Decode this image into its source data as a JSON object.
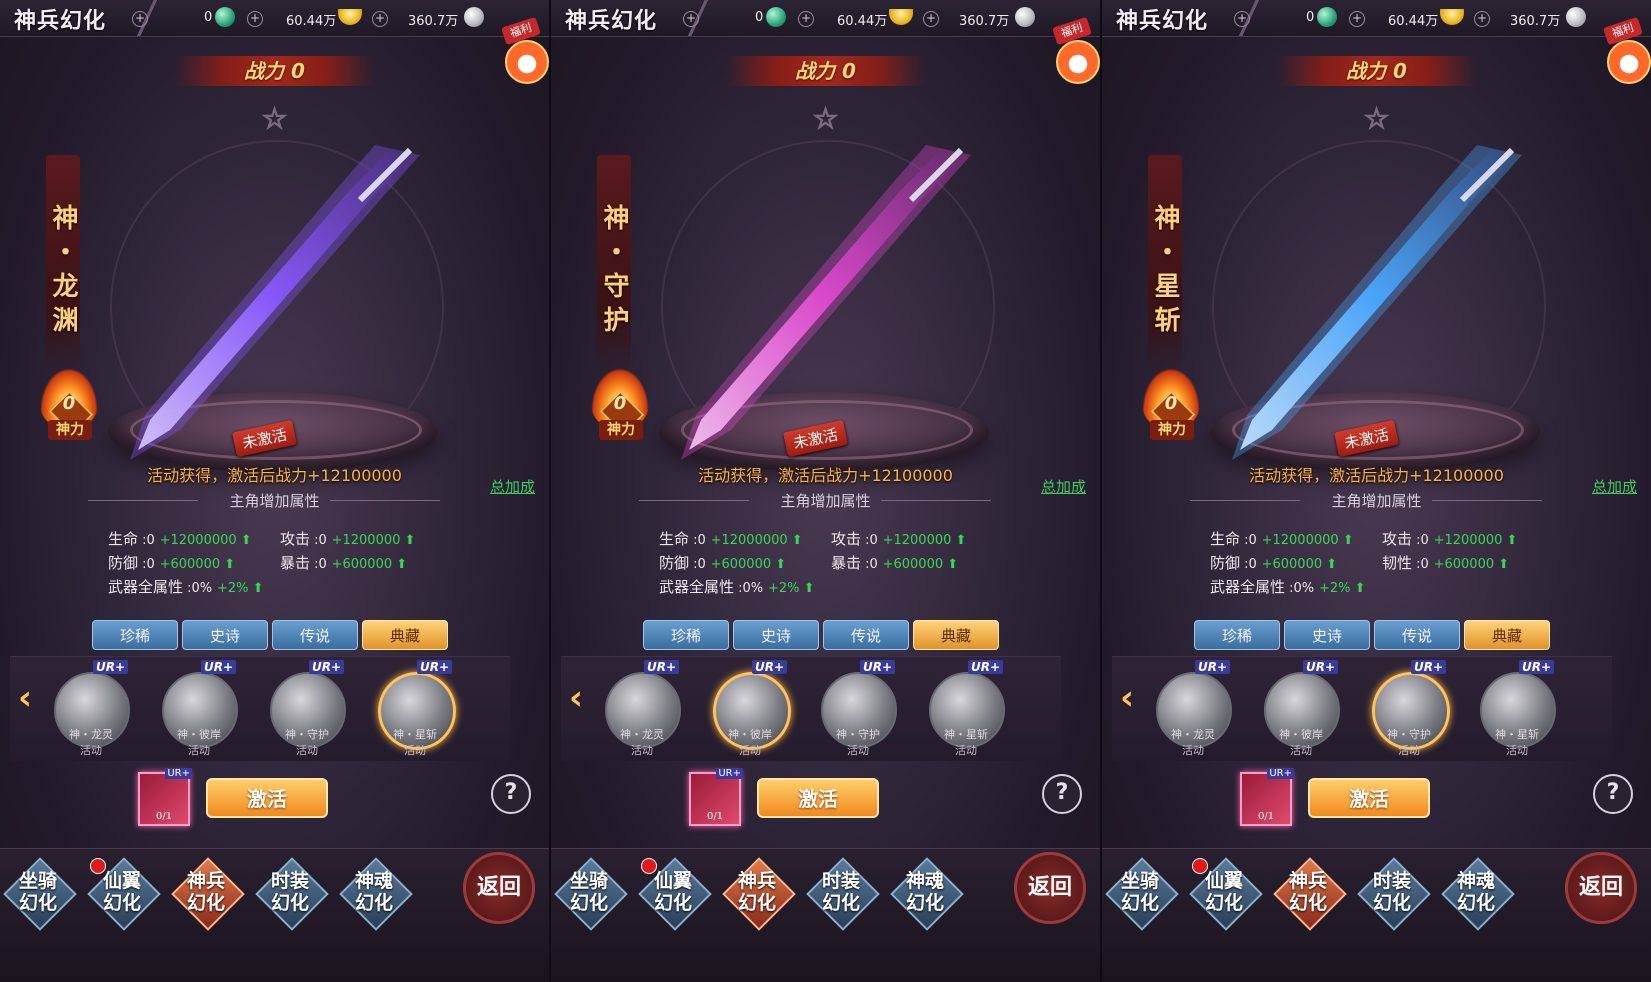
{
  "topbar": {
    "title": "神兵幻化",
    "plus": "+",
    "gem_count": "0",
    "ingot_count": "60.44万",
    "coin_count": "360.7万",
    "welfare_label": "福利"
  },
  "common": {
    "star": "☆",
    "shenli_value": "0",
    "shenli_label": "神力",
    "unactivated": "未激活",
    "gain_text": "活动获得，激活后战力+12100000",
    "total_bonus": "总加成",
    "attr_title": "主角增加属性",
    "tabs": [
      "珍稀",
      "史诗",
      "传说",
      "典藏"
    ],
    "left_arrow": "‹",
    "activate": "激活",
    "help": "?",
    "back": "返回",
    "nav": [
      "坐骑\n幻化",
      "仙翼\n幻化",
      "神兵\n幻化",
      "时装\n幻化",
      "神魂\n幻化"
    ],
    "items": [
      {
        "name": "神・龙灵",
        "source": "活动",
        "badge": "UR+"
      },
      {
        "name": "神・彼岸",
        "source": "活动",
        "badge": "UR+"
      },
      {
        "name": "神・守护",
        "source": "活动",
        "badge": "UR+"
      },
      {
        "name": "神・星斩",
        "source": "活动",
        "badge": "UR+"
      }
    ]
  },
  "panels": [
    {
      "power": "战力 0",
      "name": "神・龙渊",
      "weapon_color": "#8a5aff",
      "selected_item": 3,
      "stats": [
        {
          "label": "生命",
          "val": "0",
          "inc": "+12000000"
        },
        {
          "label": "攻击",
          "val": "0",
          "inc": "+1200000"
        },
        {
          "label": "防御",
          "val": "0",
          "inc": "+600000"
        },
        {
          "label": "暴击",
          "val": "0",
          "inc": "+600000"
        },
        {
          "label": "武器全属性",
          "val": "0%",
          "inc": "+2%"
        }
      ],
      "card_count": "0/1"
    },
    {
      "power": "战力 0",
      "name": "神・守护",
      "weapon_color": "#e04ad0",
      "selected_item": 1,
      "stats": [
        {
          "label": "生命",
          "val": "0",
          "inc": "+12000000"
        },
        {
          "label": "攻击",
          "val": "0",
          "inc": "+1200000"
        },
        {
          "label": "防御",
          "val": "0",
          "inc": "+600000"
        },
        {
          "label": "暴击",
          "val": "0",
          "inc": "+600000"
        },
        {
          "label": "武器全属性",
          "val": "0%",
          "inc": "+2%"
        }
      ],
      "card_count": "0/1"
    },
    {
      "power": "战力 0",
      "name": "神・星斩",
      "weapon_color": "#4aa8ff",
      "selected_item": 2,
      "stats": [
        {
          "label": "生命",
          "val": "0",
          "inc": "+12000000"
        },
        {
          "label": "攻击",
          "val": "0",
          "inc": "+1200000"
        },
        {
          "label": "防御",
          "val": "0",
          "inc": "+600000"
        },
        {
          "label": "韧性",
          "val": "0",
          "inc": "+600000"
        },
        {
          "label": "武器全属性",
          "val": "0%",
          "inc": "+2%"
        }
      ],
      "card_count": "0/1"
    }
  ]
}
